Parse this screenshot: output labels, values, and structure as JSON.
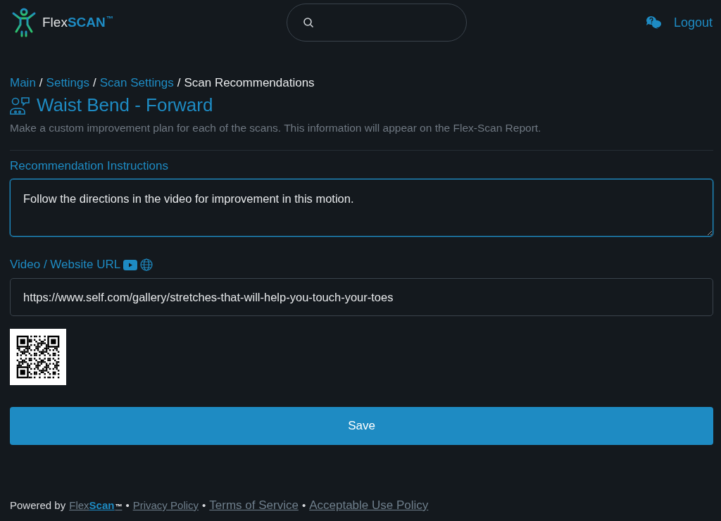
{
  "header": {
    "logo": {
      "first": "Flex",
      "second": "SCAN",
      "mark": "™"
    },
    "logout": "Logout"
  },
  "breadcrumb": [
    {
      "label": "Main",
      "kind": "link"
    },
    {
      "separator": "/",
      "label": "Settings",
      "kind": "link"
    },
    {
      "separator": "/",
      "label": "Scan Settings",
      "kind": "link"
    },
    {
      "separator": "/",
      "label": "Scan Recommendations",
      "kind": "current"
    }
  ],
  "title": "Waist Bend - Forward",
  "description": "Make a custom improvement plan for each of the scans. This information will appear on the Flex-Scan Report.",
  "instructions": {
    "label": "Recommendation Instructions",
    "value": "Follow the directions in the video for improvement in this motion.",
    "focused": true
  },
  "url": {
    "label": "Video / Website URL",
    "value": "https://www.self.com/gallery/stretches-that-will-help-you-touch-your-toes"
  },
  "save": "Save",
  "footer": {
    "powered": "Powered by",
    "brand": {
      "first": "Flex",
      "second": "Scan",
      "mark": "™"
    },
    "links": [
      {
        "separator": "•",
        "label": "Privacy Policy",
        "kind": "small"
      },
      {
        "separator": "•",
        "label": "Terms of Service",
        "kind": "large"
      },
      {
        "separator": "•",
        "label": "Acceptable Use Policy",
        "kind": "large"
      }
    ]
  }
}
